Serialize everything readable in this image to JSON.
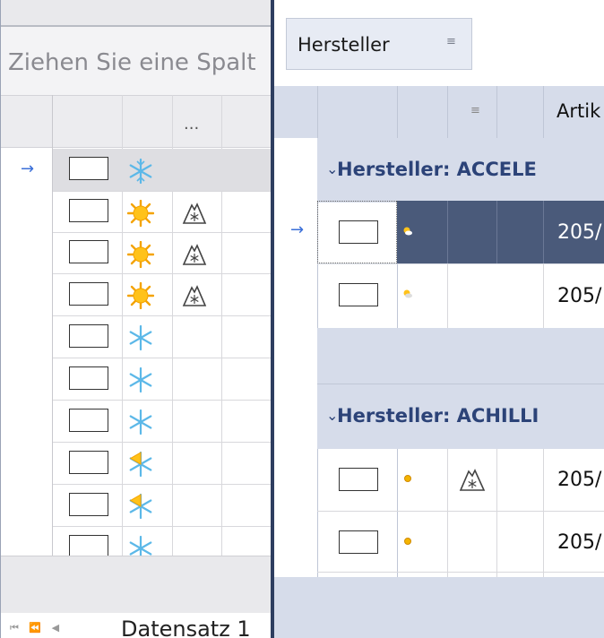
{
  "left_grid": {
    "group_panel_text": "Ziehen Sie eine Spalt",
    "header_more": "...",
    "current_row_indicator": "→",
    "rows": [
      {
        "season_icon": "snowflake-icon",
        "extra_icon": ""
      },
      {
        "season_icon": "sun-icon",
        "extra_icon": "mountain-snowflake-icon"
      },
      {
        "season_icon": "sun-icon",
        "extra_icon": "mountain-snowflake-icon"
      },
      {
        "season_icon": "sun-icon",
        "extra_icon": "mountain-snowflake-icon"
      },
      {
        "season_icon": "snowflake-icon",
        "extra_icon": ""
      },
      {
        "season_icon": "snowflake-icon",
        "extra_icon": ""
      },
      {
        "season_icon": "snowflake-icon",
        "extra_icon": ""
      },
      {
        "season_icon": "sun-snowflake-icon",
        "extra_icon": ""
      },
      {
        "season_icon": "sun-snowflake-icon",
        "extra_icon": ""
      },
      {
        "season_icon": "snowflake-icon",
        "extra_icon": ""
      }
    ],
    "navigator": {
      "buttons": "⏮ ⏪ ◀",
      "text": "Datensatz 1"
    }
  },
  "right_grid": {
    "group_chip_label": "Hersteller",
    "column_header_artikel": "Artik",
    "current_row_indicator": "→",
    "groups": [
      {
        "label": "Hersteller: ACCELE"
      },
      {
        "label": "Hersteller: ACHILLI"
      }
    ],
    "rows": [
      {
        "value": "205/",
        "season_icon": "sun-cloud-icon"
      },
      {
        "value": "205/",
        "season_icon": "sun-cloud-icon"
      },
      {
        "value": "205/",
        "season_icon": "sun-dot-icon"
      },
      {
        "value": "205/",
        "season_icon": "sun-dot-icon"
      }
    ]
  },
  "colors": {
    "splitter": "#2e3e60",
    "group_band": "#d6dcea",
    "group_text": "#2c4378",
    "selected_row": "#4a5a7a",
    "indicator_arrow": "#3a6fd8"
  }
}
